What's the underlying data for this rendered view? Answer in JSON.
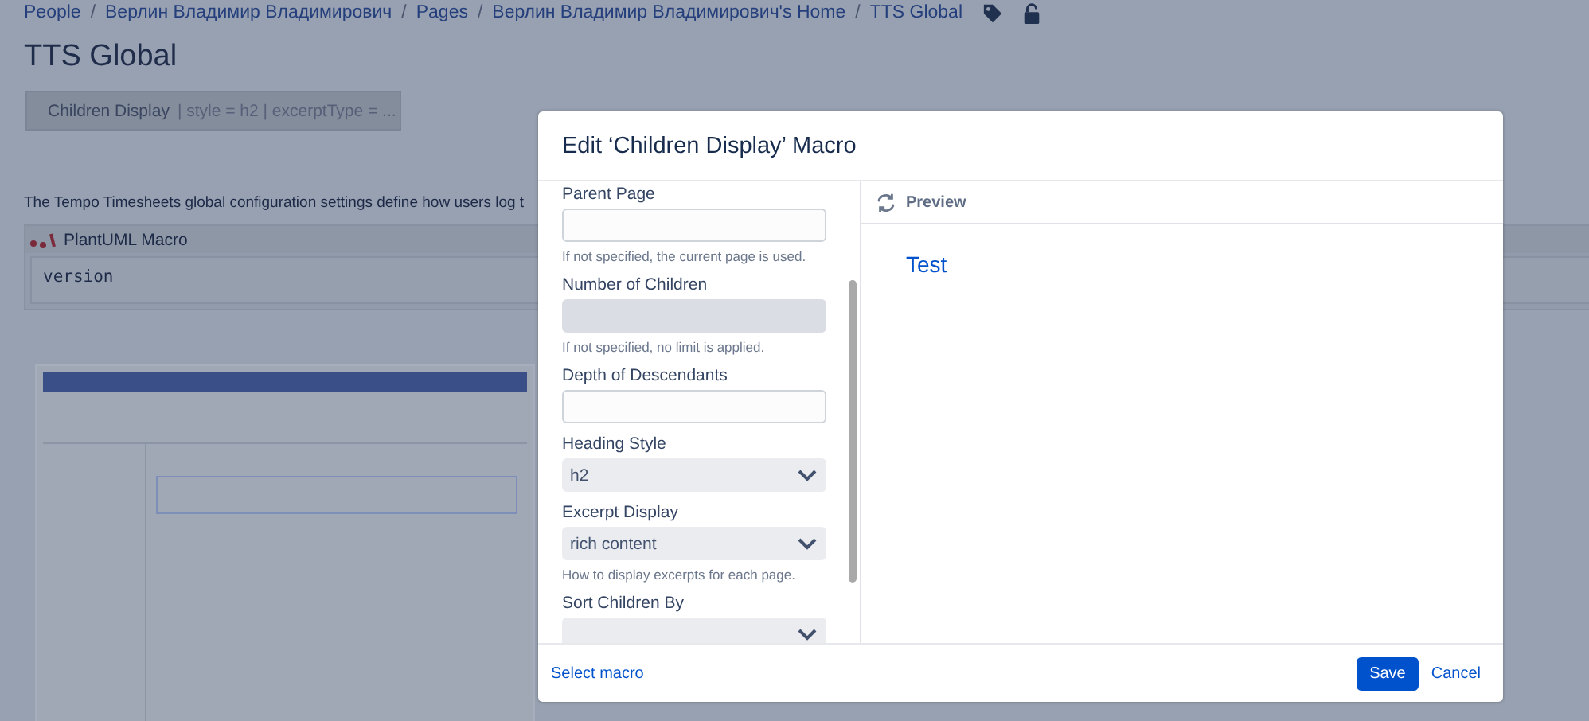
{
  "breadcrumbs": [
    {
      "label": "People"
    },
    {
      "separator": "/",
      "label": "Верлин Владимир Владимирович"
    },
    {
      "separator": "/",
      "label": "Pages"
    },
    {
      "separator": "/",
      "label": "Верлин Владимир Владимирович's Home"
    },
    {
      "separator": "/",
      "label": "TTS Global"
    }
  ],
  "page": {
    "title": "TTS Global",
    "macro_placeholder": {
      "name": "Children Display",
      "params": "| style = h2 | excerptType = ..."
    },
    "paragraph": "The Tempo Timesheets global configuration settings define how users log t",
    "code_macro": {
      "title": "PlantUML Macro",
      "code": "version"
    }
  },
  "dialog": {
    "title": "Edit ‘Children Display’ Macro",
    "fields": [
      {
        "kind": "text",
        "label": "Parent Page",
        "disabled": false,
        "help": "If not specified, the current page is used."
      },
      {
        "kind": "text",
        "label": "Number of Children",
        "disabled": true,
        "help": "If not specified, no limit is applied."
      },
      {
        "kind": "text",
        "label": "Depth of Descendants",
        "disabled": false
      },
      {
        "kind": "select",
        "label": "Heading Style",
        "value": "h2",
        "disabled": false
      },
      {
        "kind": "select",
        "label": "Excerpt Display",
        "value": "rich content",
        "disabled": false,
        "help": "How to display excerpts for each page."
      },
      {
        "kind": "select",
        "label": "Sort Children By",
        "disabled": false
      }
    ],
    "preview_label": "Preview",
    "preview_link": "Test",
    "select_macro": "Select macro",
    "save": "Save",
    "cancel": "Cancel"
  }
}
